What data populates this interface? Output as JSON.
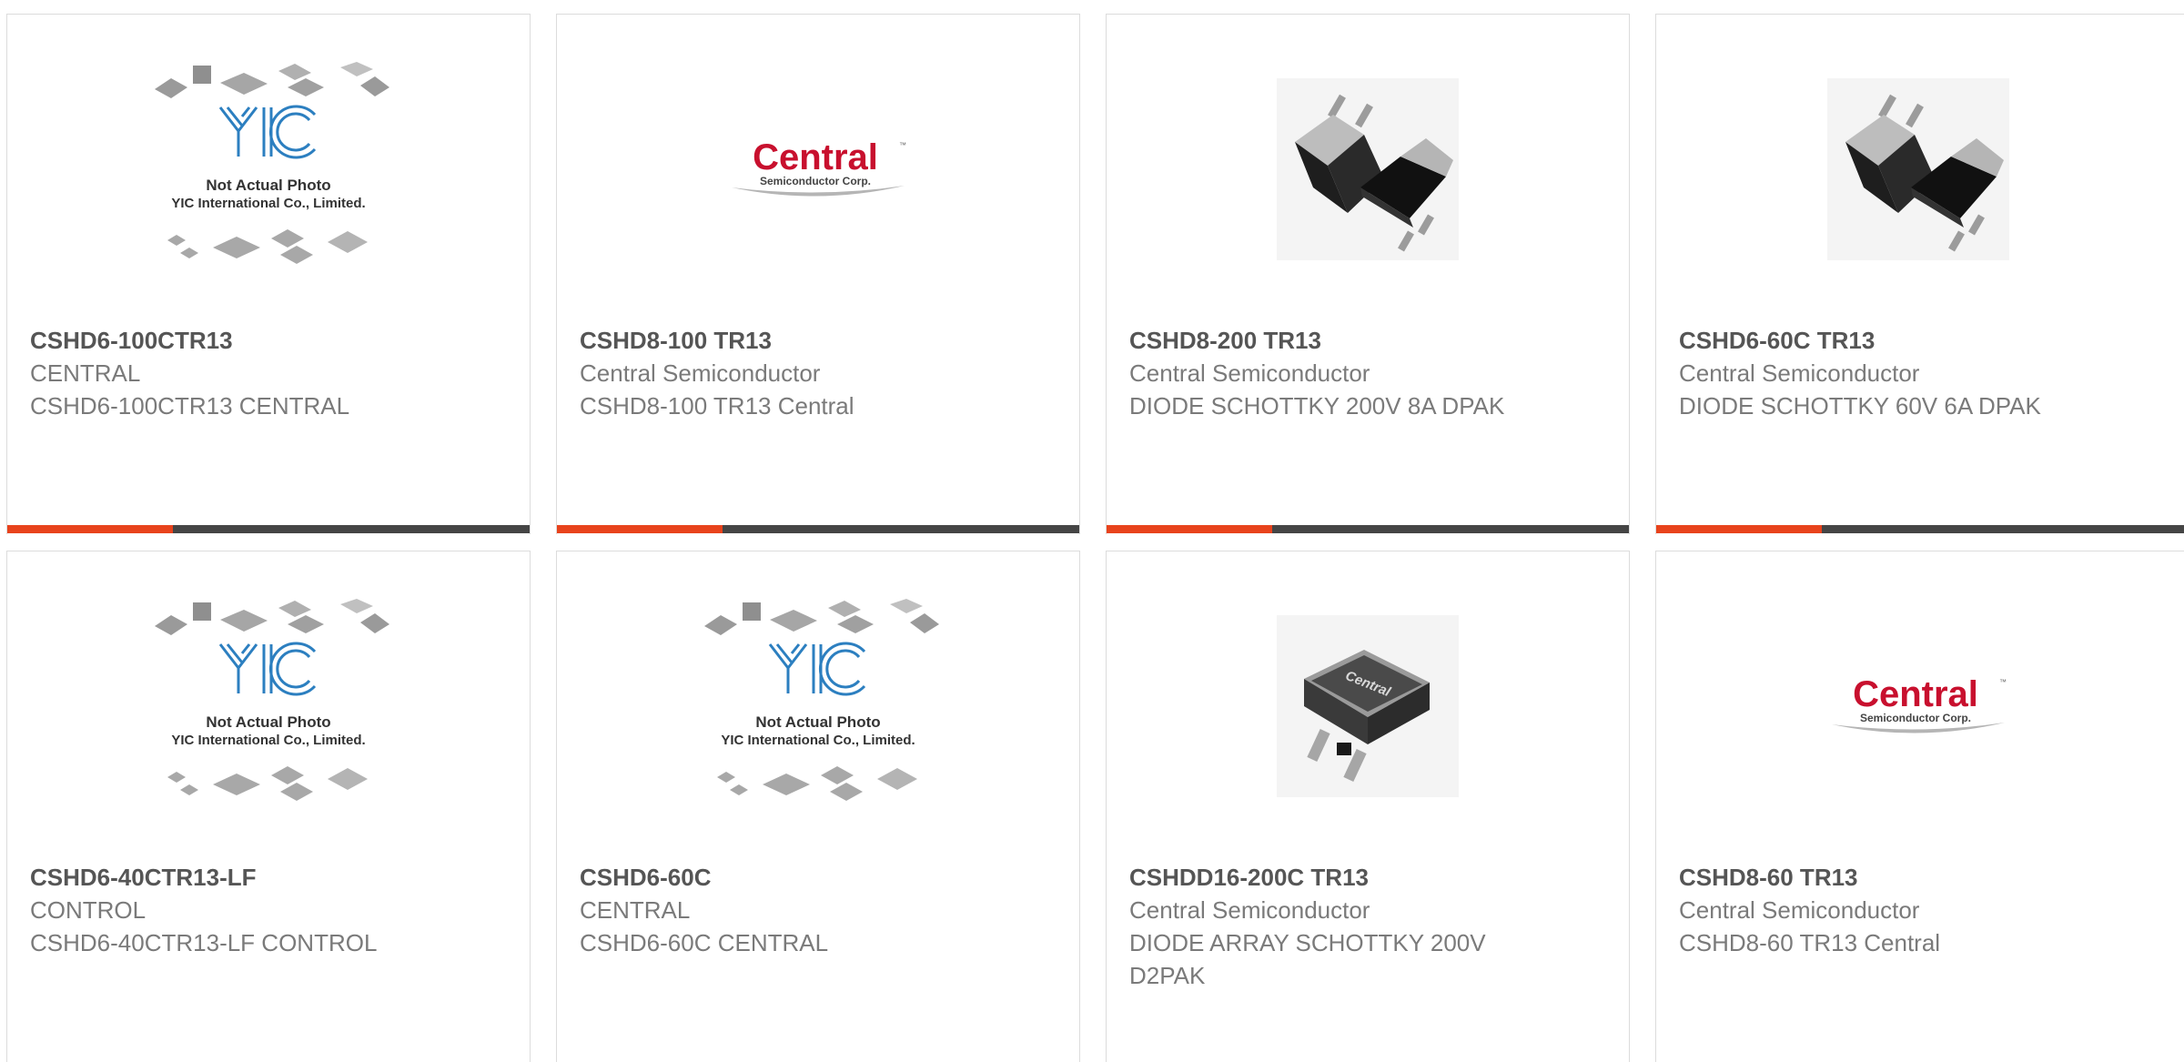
{
  "colors": {
    "accent": "#e8431c",
    "bar_dark": "#454545",
    "part_number": "#555555",
    "text_muted": "#7a7a7a",
    "yic_blue": "#2c7fc0",
    "central_red": "#c8102e"
  },
  "placeholder": {
    "logo_text": "YIC",
    "line1": "Not Actual Photo",
    "line2": "YIC International Co., Limited."
  },
  "central_logo": {
    "wordmark": "Central",
    "tagline": "Semiconductor Corp.",
    "tm": "™",
    "package_mark": "Central"
  },
  "products": [
    {
      "part_number": "CSHD6-100CTR13",
      "manufacturer": "CENTRAL",
      "description": "CSHD6-100CTR13 CENTRAL",
      "image": "yic-placeholder"
    },
    {
      "part_number": "CSHD8-100 TR13",
      "manufacturer": "Central Semiconductor",
      "description": "CSHD8-100 TR13 Central",
      "image": "central-logo"
    },
    {
      "part_number": "CSHD8-200 TR13",
      "manufacturer": "Central Semiconductor",
      "description": "DIODE SCHOTTKY 200V 8A DPAK",
      "image": "dpak-photo"
    },
    {
      "part_number": "CSHD6-60C TR13",
      "manufacturer": "Central Semiconductor",
      "description": "DIODE SCHOTTKY 60V 6A DPAK",
      "image": "dpak-photo"
    },
    {
      "part_number": "CSHD6-40CTR13-LF",
      "manufacturer": "CONTROL",
      "description": "CSHD6-40CTR13-LF CONTROL",
      "image": "yic-placeholder"
    },
    {
      "part_number": "CSHD6-60C",
      "manufacturer": "CENTRAL",
      "description": "CSHD6-60C CENTRAL",
      "image": "yic-placeholder"
    },
    {
      "part_number": "CSHDD16-200C TR13",
      "manufacturer": "Central Semiconductor",
      "description": "DIODE ARRAY SCHOTTKY 200V D2PAK",
      "image": "d2pak-photo"
    },
    {
      "part_number": "CSHD8-60 TR13",
      "manufacturer": "Central Semiconductor",
      "description": "CSHD8-60 TR13 Central",
      "image": "central-logo"
    }
  ]
}
